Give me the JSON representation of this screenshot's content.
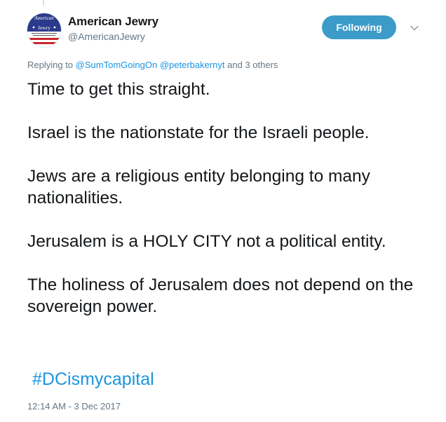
{
  "author": {
    "name": "American Jewry",
    "handle": "@AmericanJewry",
    "avatar_text_top": "American",
    "avatar_text_banner": "Jewry"
  },
  "follow_button_label": "Following",
  "replying": {
    "prefix": "Replying to",
    "mention1": "@SumTomGoingOn",
    "mention2": "@peterbakernyt",
    "suffix": "and 3 others"
  },
  "tweet": {
    "paragraphs": [
      "Time to get this straight.",
      "Israel is the nationstate for the Israeli people.",
      "Jews are a religious entity  belonging to many nationalities.",
      "Jerusalem is a HOLY CITY not a political entity.",
      "The holiness of Jerusalem does not depend on the sovereign power."
    ],
    "hashtag": "#DCismycapital",
    "timestamp": "12:14 AM - 3 Dec 2017"
  },
  "colors": {
    "follow_button_bg": "#3c9bc8",
    "link": "#1b95e0",
    "secondary_text": "#657786"
  }
}
